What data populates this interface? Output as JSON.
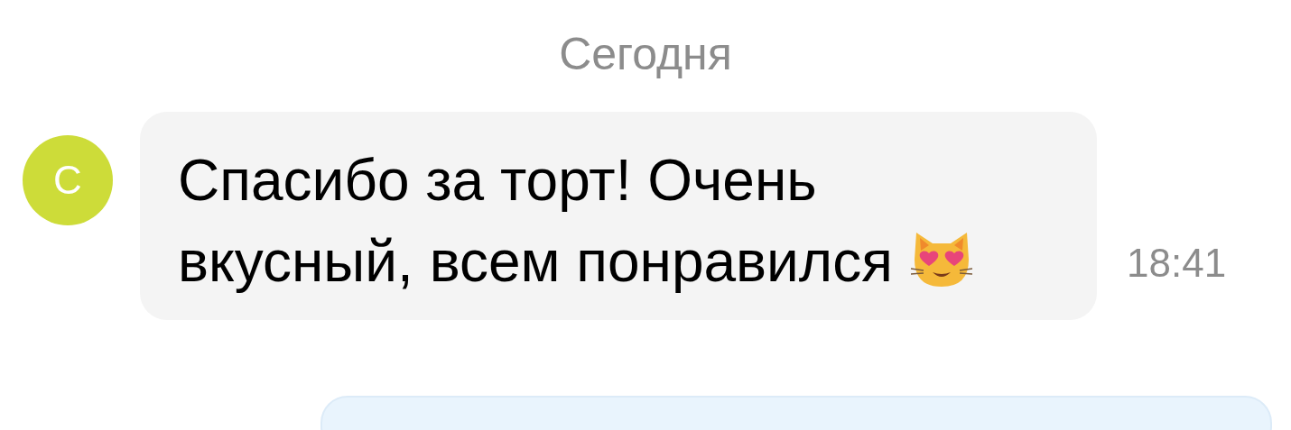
{
  "date_separator": "Сегодня",
  "messages": [
    {
      "kind": "incoming",
      "avatar": {
        "letter": "С",
        "color": "#cddc39"
      },
      "text": "Спасибо за торт! Очень вкусный, всем понравился",
      "time": "18:41"
    },
    {
      "kind": "outgoing"
    }
  ]
}
